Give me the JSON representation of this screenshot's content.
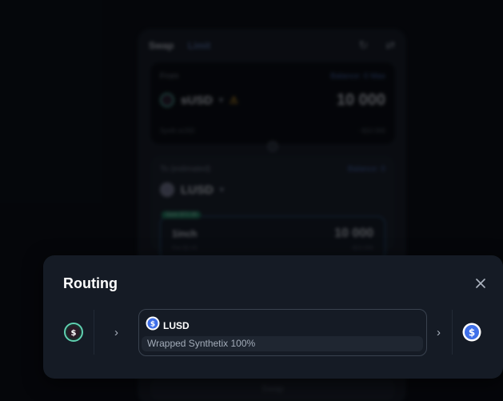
{
  "background": {
    "tabs": [
      "Swap",
      "Limit"
    ],
    "from_label": "From",
    "from_balance": "Balance: 0 Max",
    "from_token": "sUSD",
    "from_amount": "10 000",
    "from_name": "Synth sUSD",
    "from_value": "~$10 000",
    "to_label": "To (estimated)",
    "to_balance": "Balance: 0",
    "to_token": "LUSD",
    "route_badge": "Save $72.39",
    "route_name": "1inch",
    "route_amount": "10 000",
    "route_fee": "Fee $2.43",
    "route_value": "~$10 000",
    "swap_button": "Swap"
  },
  "modal": {
    "title": "Routing",
    "close_icon": "close-icon",
    "source_token_icon": "susd-token-icon",
    "hop": {
      "token_icon": "lusd-token-icon",
      "symbol": "LUSD",
      "detail": "Wrapped Synthetix 100%"
    },
    "destination_token_icon": "lusd-token-icon",
    "colors": {
      "modal_bg": "#151b25",
      "susd_ring": "#5fd0b0",
      "lusd_blue": "#3f6fe8"
    }
  }
}
